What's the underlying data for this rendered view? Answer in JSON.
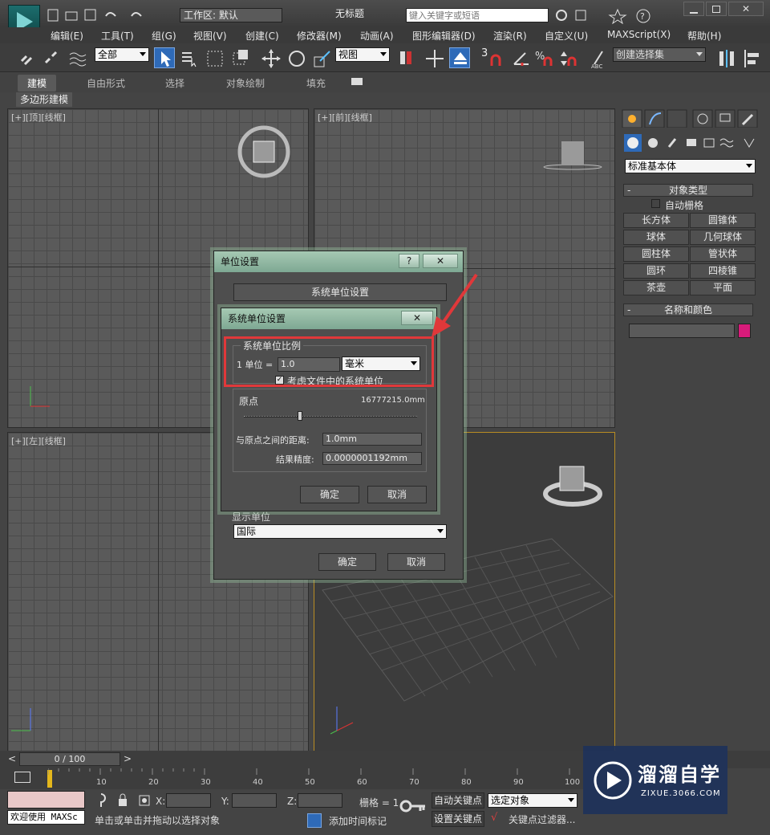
{
  "title_bar": {
    "workspace_label": "工作区: 默认",
    "doc_title": "无标题",
    "search_placeholder": "键入关键字或短语"
  },
  "menu": [
    "编辑(E)",
    "工具(T)",
    "组(G)",
    "视图(V)",
    "创建(C)",
    "修改器(M)",
    "动画(A)",
    "图形编辑器(D)",
    "渲染(R)",
    "自定义(U)",
    "MAXScript(X)",
    "帮助(H)"
  ],
  "toolbar": {
    "filter_select": "全部",
    "ref_coord_select": "视图",
    "snap_label": "3",
    "named_selection": "创建选择集"
  },
  "ribbon": {
    "tabs": [
      "建模",
      "自由形式",
      "选择",
      "对象绘制",
      "填充"
    ],
    "sub_label": "多边形建模"
  },
  "viewports": {
    "top": "[+][顶][线框]",
    "front": "[+][前][线框]",
    "left": "[+][左][线框]"
  },
  "command_panel": {
    "category_select": "标准基本体",
    "object_type_header": "对象类型",
    "auto_grid": "自动栅格",
    "buttons": [
      "长方体",
      "圆锥体",
      "球体",
      "几何球体",
      "圆柱体",
      "管状体",
      "圆环",
      "四棱锥",
      "茶壶",
      "平面"
    ],
    "name_color_header": "名称和颜色",
    "color": "#d81b7a"
  },
  "units_dialog": {
    "title": "单位设置",
    "help_btn": "?",
    "close_btn": "✕",
    "system_unit_btn": "系统单位设置",
    "section_label": "显示单位",
    "lighting_select": "国际",
    "ok": "确定",
    "cancel": "取消"
  },
  "sys_units_dialog": {
    "title": "系统单位设置",
    "close_btn": "✕",
    "group_title": "系统单位比例",
    "unit_prefix": "1 单位 =",
    "unit_value": "1.0",
    "unit_select": "毫米",
    "respect_system_units": "考虑文件中的系统单位",
    "origin_label": "原点",
    "origin_value": "16777215.0mm",
    "distance_label": "与原点之间的距离:",
    "distance_value": "1.0mm",
    "precision_label": "结果精度:",
    "precision_value": "0.0000001192mm",
    "ok": "确定",
    "cancel": "取消"
  },
  "timeline": {
    "frame_counter": "0 / 100",
    "ticks": [
      "10",
      "20",
      "30",
      "40",
      "50",
      "60",
      "70",
      "80",
      "90",
      "100"
    ]
  },
  "status": {
    "welcome": "欢迎使用 MAXSc",
    "hint": "单击或单击并拖动以选择对象",
    "x_label": "X:",
    "y_label": "Y:",
    "z_label": "Z:",
    "grid_label": "栅格 = 1",
    "auto_key": "自动关键点",
    "set_key": "设置关键点",
    "selected_select": "选定对象",
    "key_filter": "关键点过滤器...",
    "add_time_tag": "添加时间标记"
  },
  "watermark": {
    "brand": "溜溜自学",
    "site": "ZIXUE.3066.COM"
  }
}
